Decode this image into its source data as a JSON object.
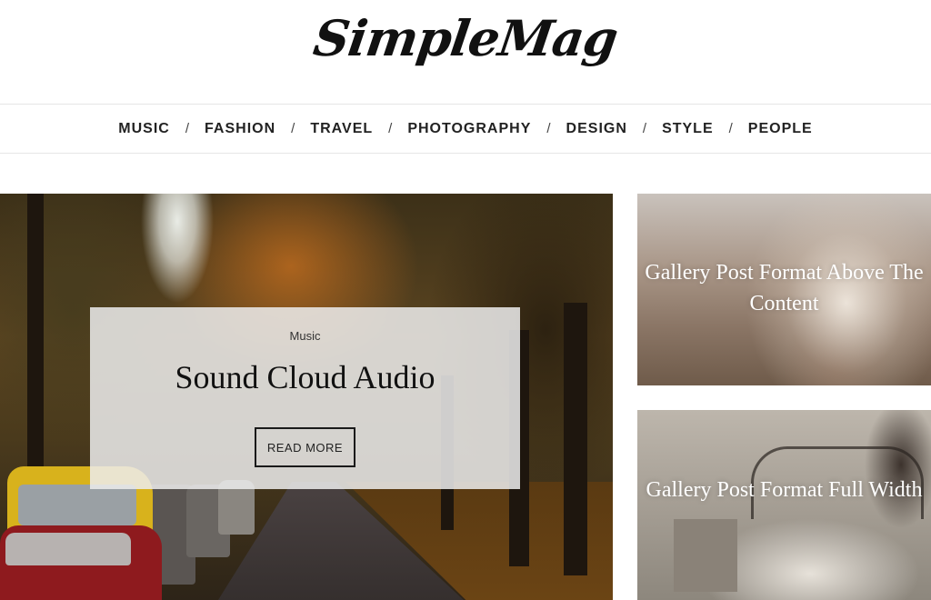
{
  "site": {
    "logo": "SimpleMag"
  },
  "nav": {
    "separator": "/",
    "items": [
      {
        "label": "MUSIC"
      },
      {
        "label": "FASHION"
      },
      {
        "label": "TRAVEL"
      },
      {
        "label": "PHOTOGRAPHY"
      },
      {
        "label": "DESIGN"
      },
      {
        "label": "STYLE"
      },
      {
        "label": "PEOPLE"
      }
    ]
  },
  "featured": {
    "category": "Music",
    "title": "Sound Cloud Audio",
    "button_label": "READ MORE"
  },
  "side_posts": [
    {
      "title": "Gallery Post Format Above The Content"
    },
    {
      "title": "Gallery Post Format Full Width"
    }
  ]
}
